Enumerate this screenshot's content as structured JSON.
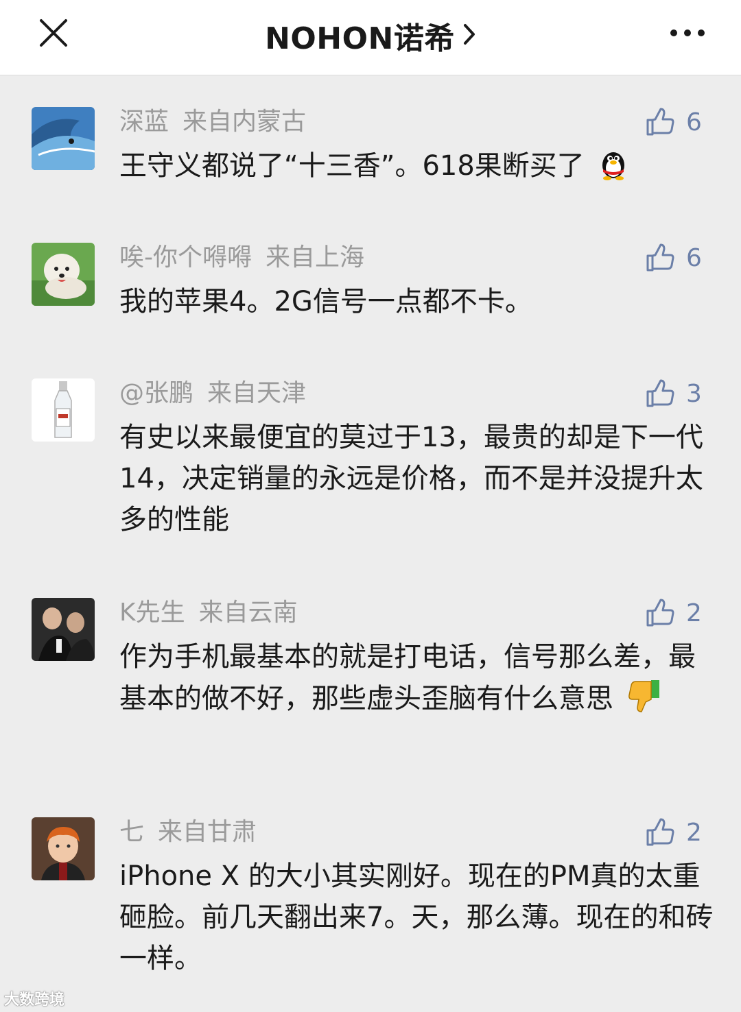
{
  "header": {
    "title": "NOHON诺希"
  },
  "comments": [
    {
      "name": "深蓝",
      "location": "来自内蒙古",
      "likes": "6",
      "text": "王守义都说了“十三香”。618果断买了",
      "emoji": "qq-penguin-emoji"
    },
    {
      "name": "唉-你个嘚嘚",
      "location": "来自上海",
      "likes": "6",
      "text": "我的苹果4。2G信号一点都不卡。"
    },
    {
      "name": "@张鹏",
      "location": "来自天津",
      "likes": "3",
      "text": "有史以来最便宜的莫过于13，最贵的却是下一代14，决定销量的永远是价格，而不是并没提升太多的性能"
    },
    {
      "name": "K先生",
      "location": "来自云南",
      "likes": "2",
      "text": "作为手机最基本的就是打电话，信号那么差，最基本的做不好，那些虚头歪脑有什么意思",
      "emoji": "thumbs-down-emoji"
    },
    {
      "name": "七",
      "location": "来自甘肃",
      "likes": "2",
      "text": "iPhone X 的大小其实刚好。现在的PM真的太重砸脸。前几天翻出来7。天，那么薄。现在的和砖一样。"
    }
  ],
  "colors": {
    "background": "#ededed",
    "like_blue": "#6b7fa8",
    "meta_gray": "#9a9a9a"
  },
  "watermark": "大数跨境"
}
